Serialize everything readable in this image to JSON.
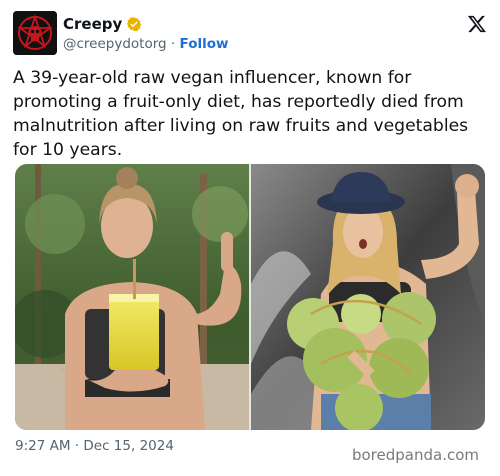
{
  "author": {
    "display_name": "Creepy",
    "handle": "@creepydotorg",
    "separator": "·",
    "follow_label": "Follow",
    "verified_color": "#e8b400",
    "avatar_icon": "pentagram-skull-icon"
  },
  "x_logo_icon": "x-logo-icon",
  "post": {
    "text": "A 39-year-old raw vegan influencer, known for promoting a fruit-only diet, has reportedly died from malnutrition after living on raw fruits and vegetables for 10 years."
  },
  "media": {
    "images": [
      {
        "name": "photo-woman-with-juice"
      },
      {
        "name": "photo-woman-with-coconuts"
      }
    ]
  },
  "meta": {
    "time": "9:27 AM",
    "separator": "·",
    "date": "Dec 15, 2024"
  },
  "watermark": "boredpanda.com",
  "colors": {
    "link": "#1d6fd6",
    "secondary_text": "#536471"
  }
}
